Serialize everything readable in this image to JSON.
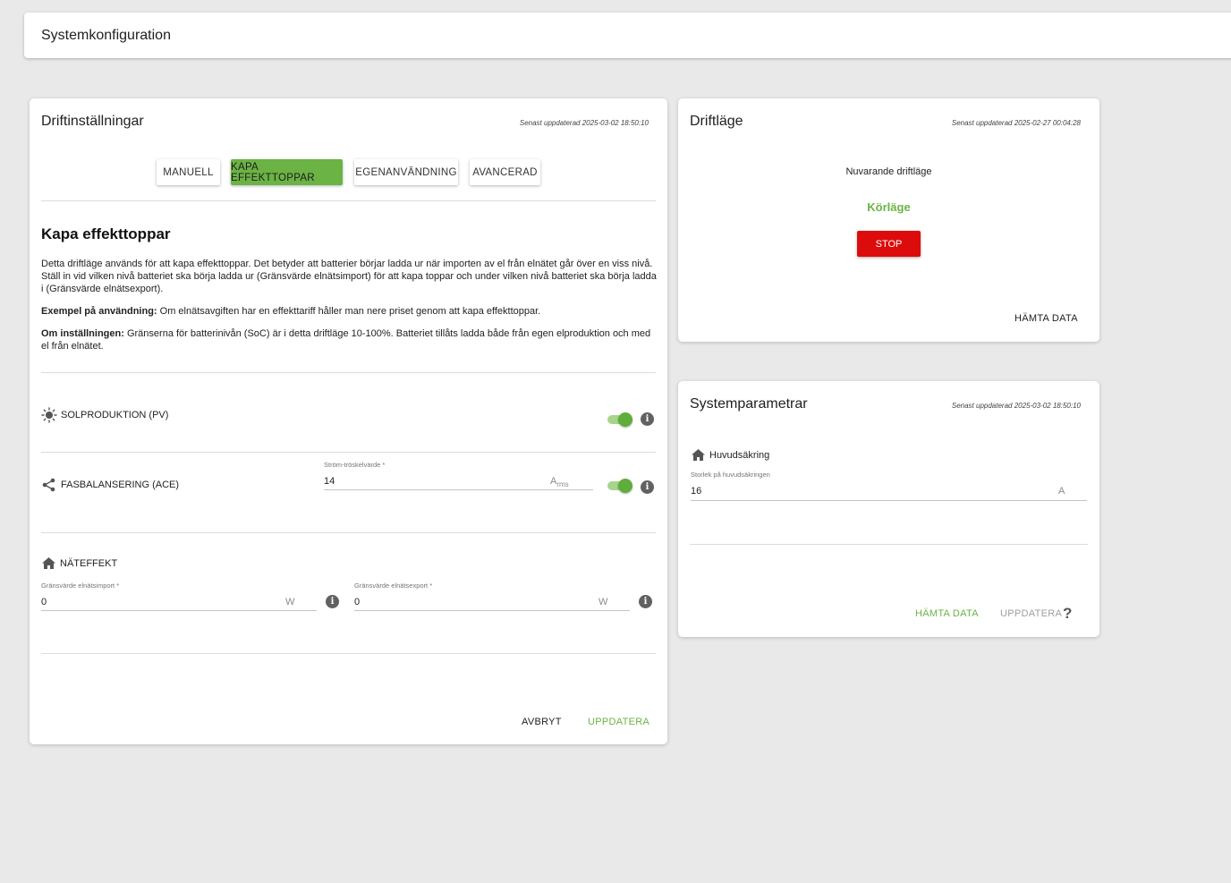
{
  "topbar": {
    "title": "Systemkonfiguration"
  },
  "operation_settings": {
    "title": "Driftinställningar",
    "last_updated": "Senast uppdaterad 2025-03-02 18:50:10",
    "tabs": [
      {
        "label": "MANUELL",
        "active": false
      },
      {
        "label": "KAPA EFFEKTTOPPAR",
        "active": true
      },
      {
        "label": "EGENANVÄNDNING",
        "active": false
      },
      {
        "label": "AVANCERAD",
        "active": false
      }
    ],
    "section_heading": "Kapa effekttoppar",
    "description": "Detta driftläge används för att kapa effekttoppar. Det betyder att batterier börjar ladda ur när importen av el från elnätet går över en viss nivå. Ställ in vid vilken nivå batteriet ska börja ladda ur (Gränsvärde elnätsimport) för att kapa toppar och under vilken nivå batteriet ska börja ladda i (Gränsvärde elnätsexport).",
    "example_label": "Exempel på användning:",
    "example_text": " Om elnätsavgiften har en effekttariff håller man nere priset genom att kapa effekttoppar.",
    "settings_label": "Om inställningen:",
    "settings_text": " Gränserna för batterinivån (SoC) är i detta driftläge 10-100%. Batteriet tillåts ladda både från egen elproduktion och med el från elnätet.",
    "pv": {
      "label": "SOLPRODUKTION (PV)",
      "enabled": true,
      "icon": "sun-icon"
    },
    "ace": {
      "label": "FASBALANSERING (ACE)",
      "enabled": true,
      "icon": "share-icon",
      "field_label": "Ström-tröskelvärde *",
      "field_value": "14",
      "unit_main": "A",
      "unit_sub": "rms"
    },
    "grid": {
      "label": "NÄTEFFEKT",
      "icon": "house-icon",
      "import_label": "Gränsvärde elnätsimport *",
      "import_value": "0",
      "import_unit": "W",
      "export_label": "Gränsvärde elnätsexport *",
      "export_value": "0",
      "export_unit": "W"
    },
    "cancel_label": "AVBRYT",
    "update_label": "UPPDATERA"
  },
  "operation_mode": {
    "title": "Driftläge",
    "last_updated": "Senast uppdaterad 2025-02-27 00:04:28",
    "current_label": "Nuvarande driftläge",
    "current_value": "Körläge",
    "stop_label": "STOP",
    "fetch_label": "HÄMTA DATA"
  },
  "system_params": {
    "title": "Systemparametrar",
    "last_updated": "Senast uppdaterad 2025-03-02 18:50:10",
    "fuse_label": "Huvudsäkring",
    "fuse_field_label": "Storlek på huvudsäkringen",
    "fuse_value": "16",
    "fuse_unit": "A",
    "fetch_label": "HÄMTA DATA",
    "update_label": "UPPDATERA",
    "help_symbol": "?"
  },
  "colors": {
    "accent": "#6bb344",
    "stop": "#dd0c0c",
    "background": "#e9e9e9"
  }
}
